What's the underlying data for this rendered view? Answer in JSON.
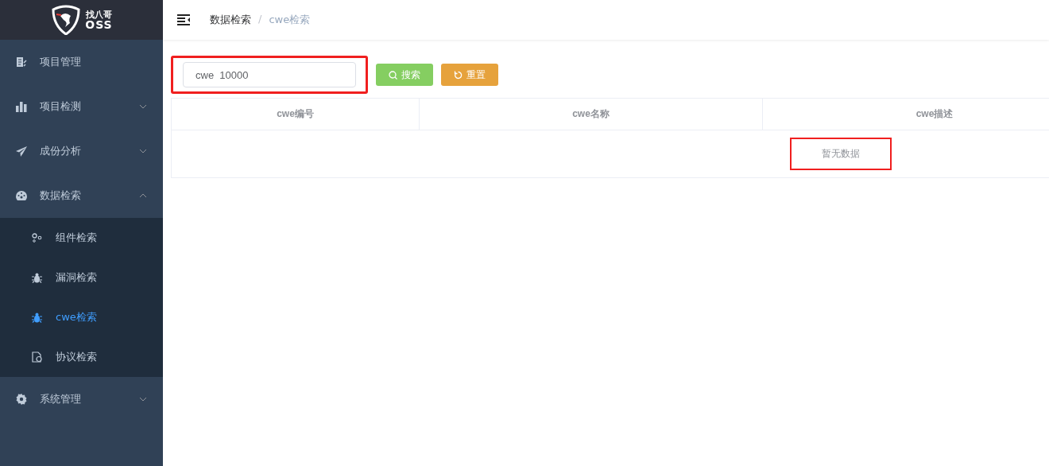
{
  "logo": {
    "title": "找八哥",
    "subtitle": "OSS"
  },
  "sidebar": {
    "items": [
      {
        "label": "项目管理",
        "kind": "document",
        "selected": false
      },
      {
        "label": "项目检测",
        "kind": "bars",
        "expandable": true,
        "expanded": false,
        "selected": false
      },
      {
        "label": "成份分析",
        "kind": "plane",
        "expandable": true,
        "expanded": false,
        "selected": false
      },
      {
        "label": "数据检索",
        "kind": "gauge",
        "expandable": true,
        "expanded": true,
        "selected": false,
        "children": [
          {
            "label": "组件检索",
            "kind": "gears",
            "selected": false
          },
          {
            "label": "漏洞检索",
            "kind": "bug",
            "selected": false
          },
          {
            "label": "cwe检索",
            "kind": "bug",
            "selected": true
          },
          {
            "label": "协议检索",
            "kind": "file",
            "selected": false
          }
        ]
      },
      {
        "label": "系统管理",
        "kind": "gear",
        "expandable": true,
        "expanded": false,
        "selected": false
      }
    ]
  },
  "breadcrumb": [
    {
      "label": "数据检索",
      "current": false
    },
    {
      "label": "cwe检索",
      "current": true
    }
  ],
  "breadcrumb_separator": "/",
  "search": {
    "value": "cwe  10000",
    "highlighted": true
  },
  "buttons": [
    {
      "label": "搜索",
      "kind": "search"
    },
    {
      "label": "重置",
      "kind": "reset"
    }
  ],
  "table": {
    "columns": [
      "cwe编号",
      "cwe名称",
      "cwe描述"
    ],
    "empty_text": "暂无数据",
    "empty_highlighted": true
  }
}
